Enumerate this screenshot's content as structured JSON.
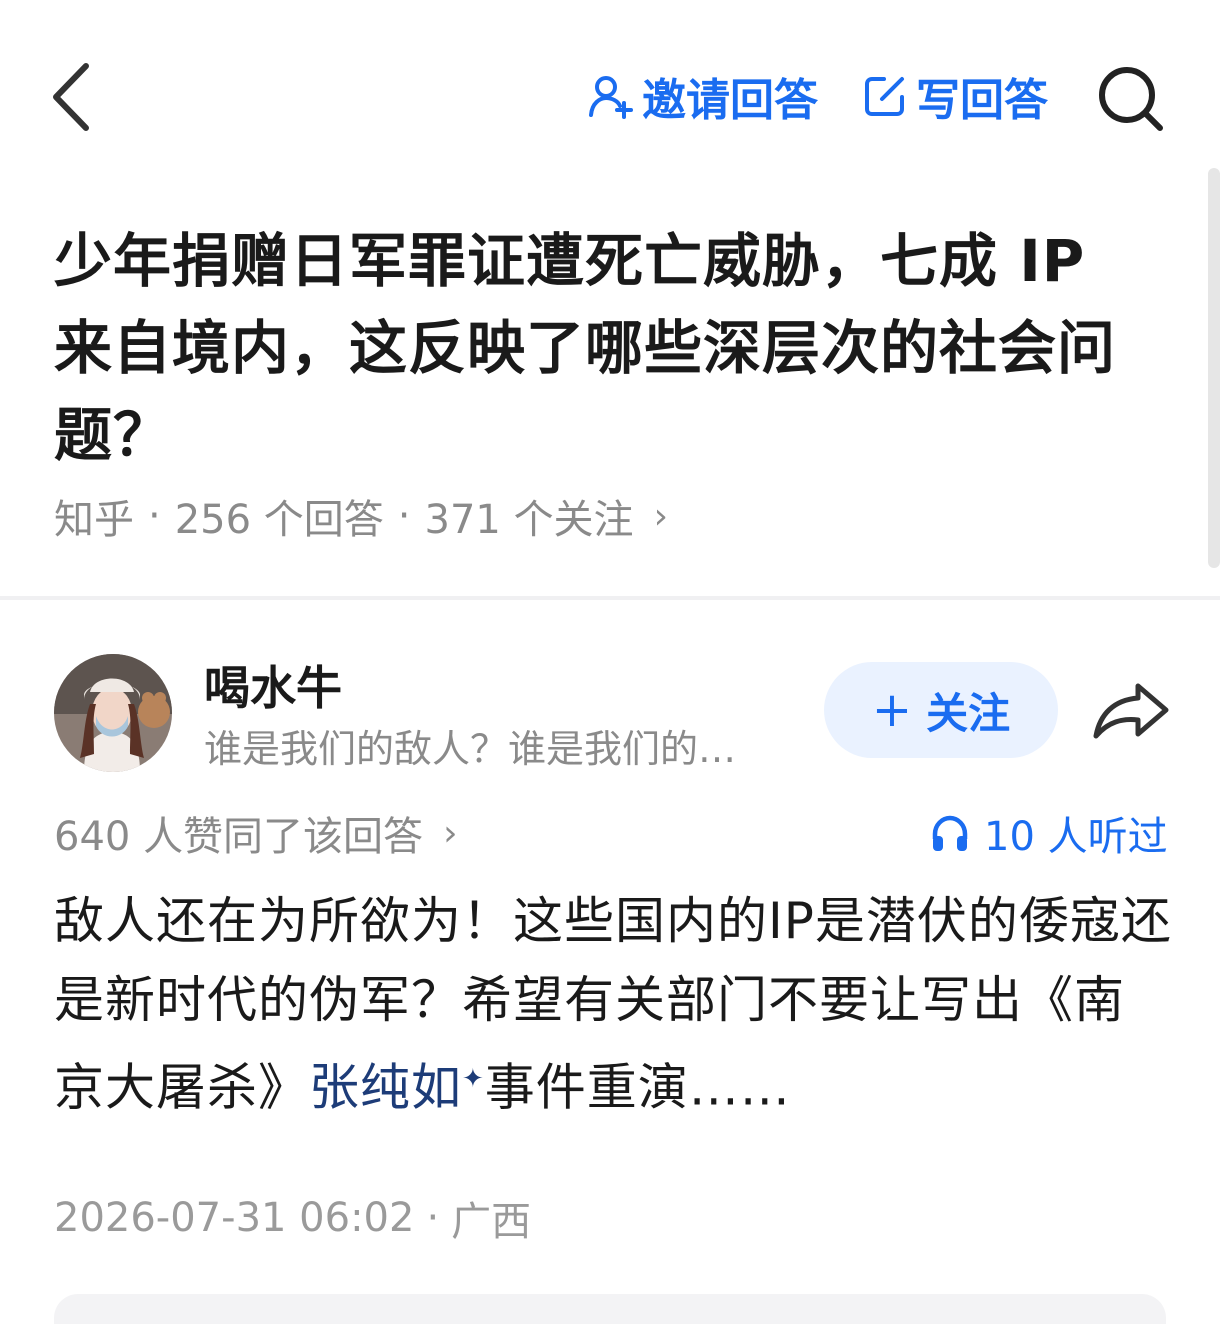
{
  "topbar": {
    "invite_label": "邀请回答",
    "write_label": "写回答",
    "accent_color": "#1a6cf0",
    "icons": [
      "back-arrow-icon",
      "invite-user-icon",
      "write-icon",
      "search-icon"
    ]
  },
  "question": {
    "title": "少年捐赠日军罪证遭死亡威胁，七成 IP 来自境内，这反映了哪些深层次的社会问题？",
    "source": "知乎",
    "answers": "256 个回答",
    "follows": "371 个关注",
    "chevron": "›"
  },
  "author": {
    "name": "喝水牛",
    "bio": "谁是我们的敌人？谁是我们的…",
    "follow_plus": "+",
    "follow_label": "关注",
    "icons": [
      "avatar",
      "share-icon"
    ]
  },
  "stats": {
    "votes": "640 人赞同了该回答",
    "votes_chevron": "›",
    "listened": "10 人听过",
    "icon": "headphones-icon"
  },
  "answer": {
    "text_before": "敌人还在为所欲为！这些国内的IP是潜伏的倭寇还是新时代的伪军？希望有关部门不要让写出《南京大屠杀》",
    "link_text": "张纯如",
    "link_sup": "✦",
    "text_after": "事件重演……"
  },
  "footer": {
    "datetime": "2026-07-31 06:02",
    "location": "广西"
  }
}
